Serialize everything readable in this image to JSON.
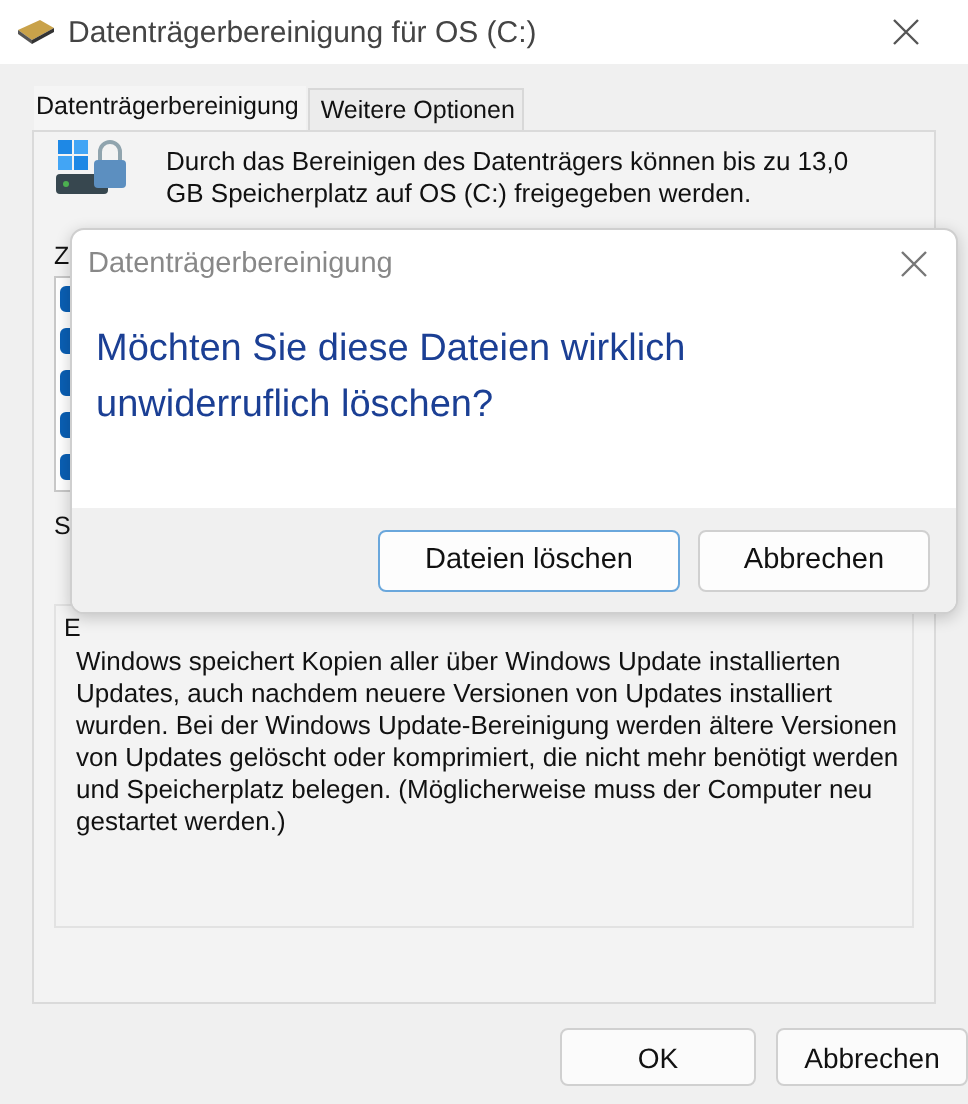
{
  "window": {
    "title": "Datenträgerbereinigung für OS (C:)"
  },
  "tabs": [
    {
      "label": "Datenträgerbereinigung",
      "selected": true
    },
    {
      "label": "Weitere Optionen",
      "selected": false
    }
  ],
  "summary": "Durch das Bereinigen des Datenträgers können bis zu 13,0 GB Speicherplatz auf OS (C:) freigegeben werden.",
  "files_label": "Z",
  "file_list": [
    {
      "checked": true
    },
    {
      "checked": true
    },
    {
      "checked": true
    },
    {
      "checked": true
    },
    {
      "checked": true
    }
  ],
  "space_label": "S",
  "description": {
    "label": "E",
    "text": "Windows speichert Kopien aller über Windows Update installierten Updates, auch nachdem neuere Versionen von Updates installiert wurden. Bei der Windows Update-Bereinigung werden ältere Versionen von Updates gelöscht oder komprimiert, die nicht mehr benötigt werden und Speicherplatz belegen. (Möglicherweise muss der Computer neu gestartet werden.)"
  },
  "buttons": [
    "OK",
    "Abbrechen"
  ],
  "confirm_dialog": {
    "title": "Datenträgerbereinigung",
    "message": "Möchten Sie diese Dateien wirklich unwiderruflich löschen?",
    "buttons": [
      {
        "label": "Dateien löschen",
        "default": true
      },
      {
        "label": "Abbrechen",
        "default": false
      }
    ]
  }
}
